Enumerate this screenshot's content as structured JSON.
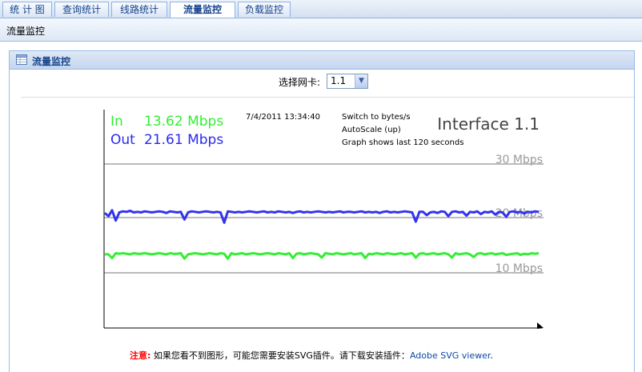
{
  "tabs": [
    {
      "label": "统 计 图",
      "active": false
    },
    {
      "label": "查询统计",
      "active": false
    },
    {
      "label": "线路统计",
      "active": false
    },
    {
      "label": "流量监控",
      "active": true
    },
    {
      "label": "负载监控",
      "active": false
    }
  ],
  "breadcrumb": "流量监控",
  "panel": {
    "title": "流量监控",
    "nic_label": "选择网卡:",
    "nic_value": "1.1"
  },
  "graph": {
    "in_label": "In",
    "in_value": "13.62 Mbps",
    "out_label": "Out",
    "out_value": "21.61 Mbps",
    "timestamp": "7/4/2011 13:34:40",
    "switch_link": "Switch to bytes/s",
    "autoscale": "AutoScale (up)",
    "window_note": "Graph shows last 120 seconds",
    "interface_title": "Interface 1.1",
    "gridlines": [
      "30 Mbps",
      "20 Mbps",
      "10 Mbps"
    ],
    "colors": {
      "in": "#33ee33",
      "out": "#3333ee",
      "grid": "#bbbbbb"
    }
  },
  "chart_data": {
    "type": "line",
    "ylim": [
      0,
      30
    ],
    "series": [
      {
        "name": "Out",
        "values": [
          21,
          20.4,
          21.5,
          19.6,
          21.1,
          21.3,
          21.2,
          21.4,
          21.1,
          21.2,
          21.1,
          21.3,
          21.2,
          21.1,
          21.2,
          21.3,
          21.2,
          21,
          21.3,
          21.2,
          21.1,
          21.2,
          19.8,
          21.1,
          21.3,
          21.2,
          21.1,
          21.2,
          21.3,
          21.2,
          21.1,
          21.2,
          21.1,
          19.2,
          21.3,
          21.2,
          21.1,
          21.2,
          21.1,
          21.2,
          21.3,
          21.2,
          21.1,
          21.2,
          21.3,
          21.1,
          21.2,
          21.1,
          21.3,
          21.2,
          21.1,
          21.2,
          21,
          21.2,
          21.3,
          21.1,
          21.2,
          21.1,
          21.2,
          21.3,
          21.2,
          21.1,
          21.2,
          21.1,
          21.2,
          21.3,
          21.1,
          21.2,
          21.2,
          21.1,
          21.2,
          21.3,
          21.1,
          21.2,
          21.1,
          21.2,
          21,
          21.2,
          21.3,
          21.1,
          21.2,
          21.1,
          21.2,
          21.3,
          21.2,
          21.1,
          19.4,
          21.2,
          21.2,
          20.6,
          21.1,
          21.2,
          21,
          21.3,
          21.2,
          20.4,
          21.2,
          21.3,
          21.1,
          21.2,
          20.5,
          21.2,
          21.1,
          21.3,
          20.8,
          21.2,
          21.1,
          21.3,
          20.7,
          21.2,
          21.1,
          20.3,
          21.2,
          21.3,
          21.1,
          21.2,
          20.9,
          21.2,
          21.1,
          21.3,
          21.2
        ]
      },
      {
        "name": "In",
        "values": [
          13.4,
          13.4,
          12.7,
          13.6,
          13.5,
          13.6,
          13.5,
          13.4,
          13.6,
          13.5,
          13.5,
          13.6,
          13.5,
          13.4,
          13.5,
          13.6,
          13.5,
          13.4,
          13.6,
          13.5,
          13.5,
          13.6,
          12.6,
          13.4,
          13.5,
          13.6,
          13.5,
          13.4,
          13.5,
          13.6,
          13.5,
          13.4,
          13.6,
          13.5,
          12.6,
          13.6,
          13.4,
          13.5,
          13.6,
          13.4,
          13.5,
          13.6,
          13.5,
          13.4,
          13.5,
          13.6,
          13.5,
          13.4,
          13.6,
          13.5,
          13.4,
          13.6,
          12.7,
          13.5,
          13.6,
          13.4,
          13.5,
          13.6,
          13.5,
          13.4,
          12.8,
          13.6,
          13.5,
          13.4,
          13.6,
          13.5,
          13.4,
          13.5,
          13.6,
          13.4,
          13.5,
          13.6,
          12.7,
          13.5,
          13.4,
          13.6,
          13.5,
          13.4,
          13.6,
          13.5,
          13.4,
          13.5,
          13.6,
          13.4,
          13.5,
          13.6,
          12.8,
          13.5,
          13.6,
          13.4,
          13.5,
          13.6,
          13.4,
          13.5,
          13.6,
          13.4,
          12.8,
          13.6,
          13.4,
          13.5,
          13.6,
          13.4,
          12.9,
          13.5,
          13.6,
          13.4,
          13.5,
          13.6,
          13.4,
          13.5,
          13.6,
          13.3,
          13.4,
          13.5,
          13.6,
          13.3,
          13.5,
          13.4,
          13.6,
          13.5,
          13.6
        ]
      }
    ]
  },
  "notice": {
    "warning": "注意:",
    "text": "如果您看不到图形，可能您需要安装SVG插件。请下载安装插件：",
    "link": "Adobe SVG viewer",
    "end": "."
  }
}
